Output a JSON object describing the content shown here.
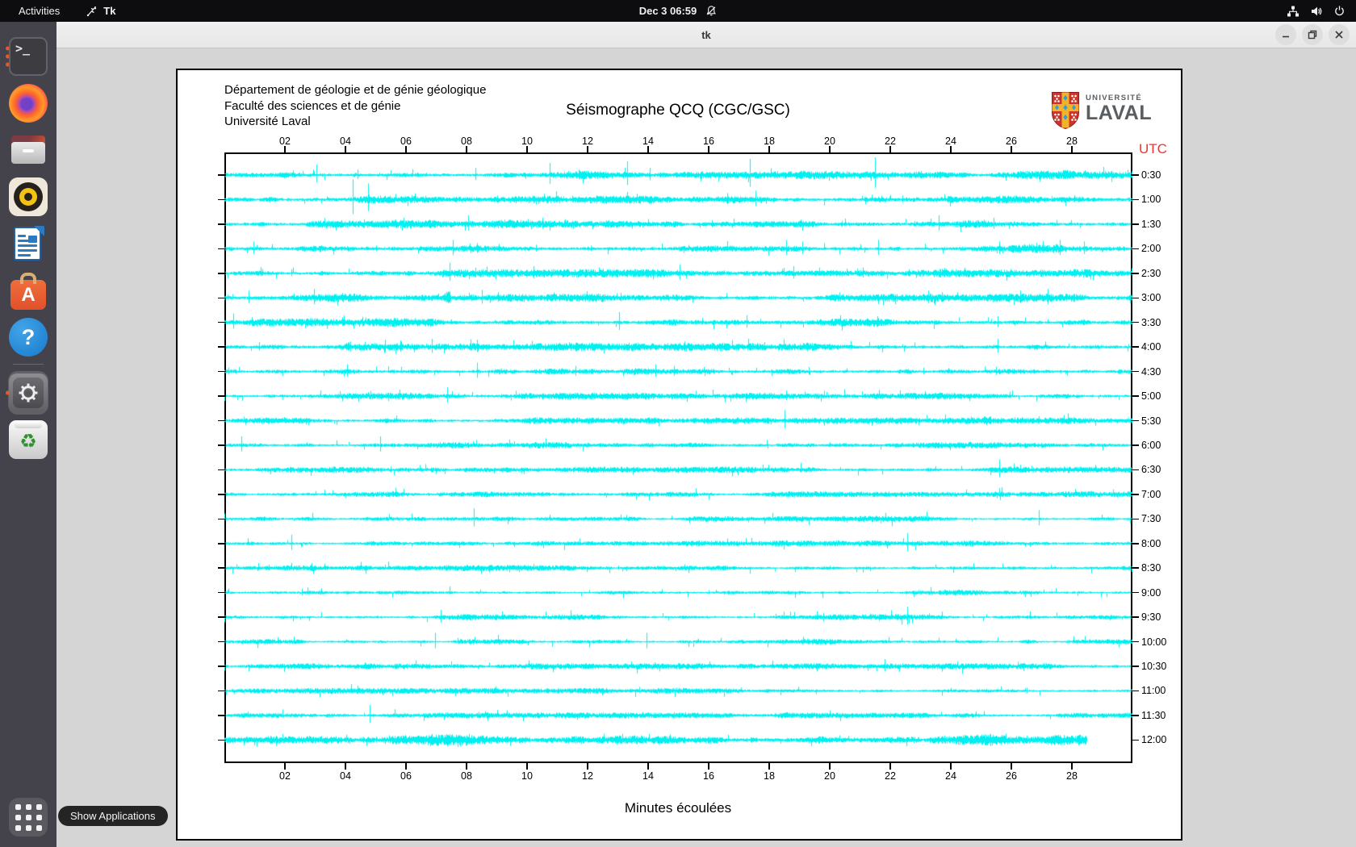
{
  "top_bar": {
    "activities": "Activities",
    "app_name": "Tk",
    "clock": "Dec 3 06:59",
    "status_icons": [
      "network-icon",
      "volume-icon",
      "power-icon"
    ],
    "notifications_muted": true
  },
  "window": {
    "title": "tk",
    "controls": [
      "minimize",
      "maximize",
      "close"
    ]
  },
  "dock": {
    "tooltip": "Show Applications",
    "items": [
      {
        "name": "terminal",
        "running_windows": 3,
        "active": false
      },
      {
        "name": "firefox",
        "active": false
      },
      {
        "name": "files",
        "active": false
      },
      {
        "name": "rhythmbox",
        "active": false
      },
      {
        "name": "libreoffice-writer",
        "active": false
      },
      {
        "name": "ubuntu-software",
        "active": false
      },
      {
        "name": "help",
        "active": false
      },
      {
        "name": "settings",
        "running_windows": 1,
        "active": true
      },
      {
        "name": "trash",
        "active": false
      },
      {
        "name": "show-applications",
        "active": false
      }
    ]
  },
  "figure": {
    "institution_lines": [
      "Département de géologie et de génie géologique",
      "Faculté des sciences et de génie",
      "Université Laval"
    ],
    "title": "Séismographe QCQ (CGC/GSC)",
    "logo": {
      "line1": "UNIVERSITÉ",
      "line2": "LAVAL"
    },
    "utc_label": "UTC",
    "xlabel": "Minutes écoulées"
  },
  "colors": {
    "trace": "#00F0F0",
    "utc_red": "#F23131",
    "ubuntu_orange": "#E8582A"
  },
  "chart_data": {
    "type": "line",
    "title": "Séismographe QCQ (CGC/GSC)",
    "xlabel": "Minutes écoulées",
    "x_range_minutes": [
      0,
      30
    ],
    "x_ticks": [
      "02",
      "04",
      "06",
      "08",
      "10",
      "12",
      "14",
      "16",
      "18",
      "20",
      "22",
      "24",
      "26",
      "28"
    ],
    "grid": false,
    "legend": "none",
    "description": "24 half-hour seismogram sweeps, UTC 0:30 to 12:00, cyan traces on white; spikes = [minute, amplitude_px, optional_width_px]",
    "rows": [
      {
        "utc": "0:30",
        "noise": 1.7,
        "spikes": [
          [
            3.05,
            13
          ],
          [
            4.4,
            7
          ],
          [
            8.3,
            9
          ],
          [
            10.75,
            15
          ],
          [
            11.7,
            7
          ],
          [
            13.3,
            17
          ],
          [
            14.05,
            9
          ],
          [
            17.35,
            20
          ],
          [
            21.5,
            22
          ],
          [
            23.0,
            5
          ],
          [
            26.3,
            5
          ],
          [
            27.9,
            6,
            14
          ]
        ]
      },
      {
        "utc": "1:00",
        "noise": 1.7,
        "spikes": [
          [
            4.25,
            25
          ],
          [
            4.75,
            20
          ],
          [
            9.0,
            5
          ],
          [
            11.5,
            5
          ],
          [
            16.6,
            8
          ],
          [
            17.55,
            11
          ],
          [
            22.4,
            5
          ]
        ]
      },
      {
        "utc": "1:30",
        "noise": 1.7,
        "spikes": [
          [
            4.6,
            6
          ],
          [
            8.05,
            11
          ],
          [
            10.5,
            8
          ],
          [
            11.25,
            6
          ],
          [
            16.1,
            5
          ],
          [
            20.4,
            4
          ],
          [
            23.6,
            11
          ],
          [
            25.4,
            8
          ]
        ]
      },
      {
        "utc": "2:00",
        "noise": 1.8,
        "spikes": [
          [
            0.95,
            9
          ],
          [
            5.0,
            4
          ],
          [
            7.55,
            11
          ],
          [
            8.35,
            7
          ],
          [
            10.3,
            5
          ],
          [
            12.1,
            4
          ],
          [
            18.55,
            11
          ],
          [
            19.1,
            9
          ],
          [
            21.6,
            11
          ],
          [
            25.6,
            9
          ],
          [
            27.6,
            11
          ],
          [
            28.4,
            9
          ]
        ]
      },
      {
        "utc": "2:30",
        "noise": 1.7,
        "spikes": [
          [
            2.2,
            5
          ],
          [
            7.45,
            13
          ],
          [
            8.3,
            7
          ],
          [
            10.2,
            9
          ],
          [
            15.05,
            11
          ],
          [
            18.8,
            9
          ],
          [
            21.1,
            7
          ],
          [
            22.6,
            5
          ],
          [
            26.8,
            4
          ]
        ]
      },
      {
        "utc": "3:00",
        "noise": 1.7,
        "spikes": [
          [
            0.8,
            9
          ],
          [
            2.95,
            11
          ],
          [
            3.9,
            6
          ],
          [
            7.35,
            8,
            8
          ],
          [
            8.5,
            10
          ],
          [
            9.05,
            7
          ],
          [
            13.1,
            6
          ],
          [
            23.25,
            9
          ],
          [
            23.7,
            7
          ],
          [
            26.3,
            9
          ],
          [
            27.2,
            11
          ]
        ]
      },
      {
        "utc": "3:30",
        "noise": 1.7,
        "spikes": [
          [
            0.3,
            11
          ],
          [
            4.55,
            7
          ],
          [
            5.6,
            6
          ],
          [
            13.05,
            13
          ],
          [
            17.25,
            9
          ],
          [
            25.55,
            8
          ]
        ]
      },
      {
        "utc": "4:00",
        "noise": 1.7,
        "spikes": [
          [
            1.15,
            6
          ],
          [
            4.1,
            7,
            6
          ],
          [
            5.3,
            9
          ],
          [
            5.8,
            8
          ],
          [
            6.85,
            10
          ],
          [
            8.35,
            9
          ],
          [
            15.2,
            7
          ],
          [
            17.85,
            6
          ],
          [
            25.55,
            10
          ]
        ]
      },
      {
        "utc": "4:30",
        "noise": 1.7,
        "spikes": [
          [
            4.05,
            9
          ],
          [
            8.35,
            11
          ],
          [
            11.6,
            7
          ],
          [
            14.25,
            9
          ],
          [
            14.85,
            7
          ],
          [
            19.3,
            5
          ],
          [
            23.1,
            5
          ],
          [
            25.5,
            6
          ]
        ]
      },
      {
        "utc": "5:00",
        "noise": 1.4,
        "spikes": [
          [
            7.35,
            11
          ],
          [
            10.1,
            4
          ],
          [
            18.55,
            7
          ],
          [
            24.1,
            4
          ]
        ]
      },
      {
        "utc": "5:30",
        "noise": 1.3,
        "spikes": [
          [
            18.5,
            13
          ],
          [
            25.2,
            5,
            10
          ]
        ]
      },
      {
        "utc": "6:00",
        "noise": 1.3,
        "spikes": [
          [
            0.55,
            11
          ],
          [
            5.15,
            11
          ],
          [
            12.0,
            3
          ]
        ]
      },
      {
        "utc": "6:30",
        "noise": 1.3,
        "spikes": [
          [
            5.5,
            4
          ],
          [
            25.6,
            13
          ]
        ]
      },
      {
        "utc": "7:00",
        "noise": 1.3,
        "spikes": [
          [
            10.5,
            3
          ],
          [
            19.0,
            3
          ]
        ]
      },
      {
        "utc": "7:30",
        "noise": 1.2,
        "spikes": [
          [
            8.25,
            13
          ],
          [
            26.9,
            11
          ]
        ]
      },
      {
        "utc": "8:00",
        "noise": 1.2,
        "spikes": [
          [
            2.2,
            11
          ],
          [
            22.55,
            13
          ]
        ]
      },
      {
        "utc": "8:30",
        "noise": 1.2,
        "spikes": [
          [
            13.0,
            3
          ],
          [
            20.0,
            3
          ]
        ]
      },
      {
        "utc": "9:00",
        "noise": 1.2,
        "spikes": [
          [
            2.55,
            5
          ],
          [
            16.0,
            3
          ]
        ]
      },
      {
        "utc": "9:30",
        "noise": 1.2,
        "spikes": [
          [
            7.15,
            9
          ],
          [
            22.55,
            13
          ]
        ]
      },
      {
        "utc": "10:00",
        "noise": 1.2,
        "spikes": [
          [
            6.95,
            11
          ],
          [
            13.95,
            11
          ]
        ]
      },
      {
        "utc": "10:30",
        "noise": 1.2,
        "spikes": [
          [
            21.8,
            9
          ]
        ]
      },
      {
        "utc": "11:00",
        "noise": 1.2,
        "spikes": [
          [
            9.0,
            3
          ],
          [
            26.5,
            4
          ]
        ]
      },
      {
        "utc": "11:30",
        "noise": 1.2,
        "spikes": [
          [
            4.8,
            13
          ]
        ]
      },
      {
        "utc": "12:00",
        "noise": 2.4,
        "end_min": 28.5,
        "spikes": [
          [
            5.0,
            4
          ],
          [
            6.4,
            5,
            12
          ],
          [
            9.4,
            4,
            10
          ],
          [
            12.0,
            3
          ],
          [
            17.5,
            4,
            8
          ],
          [
            25.5,
            4,
            12
          ]
        ]
      }
    ]
  }
}
